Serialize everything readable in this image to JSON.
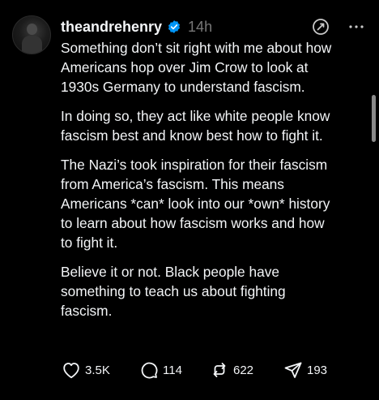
{
  "post": {
    "username": "theandrehenry",
    "timestamp": "14h",
    "paragraphs": [
      "Something don’t sit right with me about how\nAmericans hop over Jim Crow to look at\n1930s Germany to understand fascism.",
      "In doing so, they act like white people know\nfascism best and know best how to fight it.",
      "The Nazi’s took inspiration for their fascism\nfrom America’s fascism. This means\nAmericans *can* look into our *own* history\nto learn about how fascism works and how\nto fight it.",
      "Believe it or not. Black people have\nsomething to teach us about fighting\nfascism."
    ],
    "actions": {
      "likes": "3.5K",
      "replies": "114",
      "reposts": "622",
      "shares": "193"
    }
  },
  "colors": {
    "background": "#000000",
    "text": "#f3f5f7",
    "muted": "#777777",
    "verified": "#0095f6"
  },
  "icons": {
    "verified": "verified-badge-icon",
    "translate": "translate-icon",
    "more": "more-horizontal-icon",
    "like": "heart-icon",
    "reply": "comment-icon",
    "repost": "repost-icon",
    "share": "share-icon"
  }
}
